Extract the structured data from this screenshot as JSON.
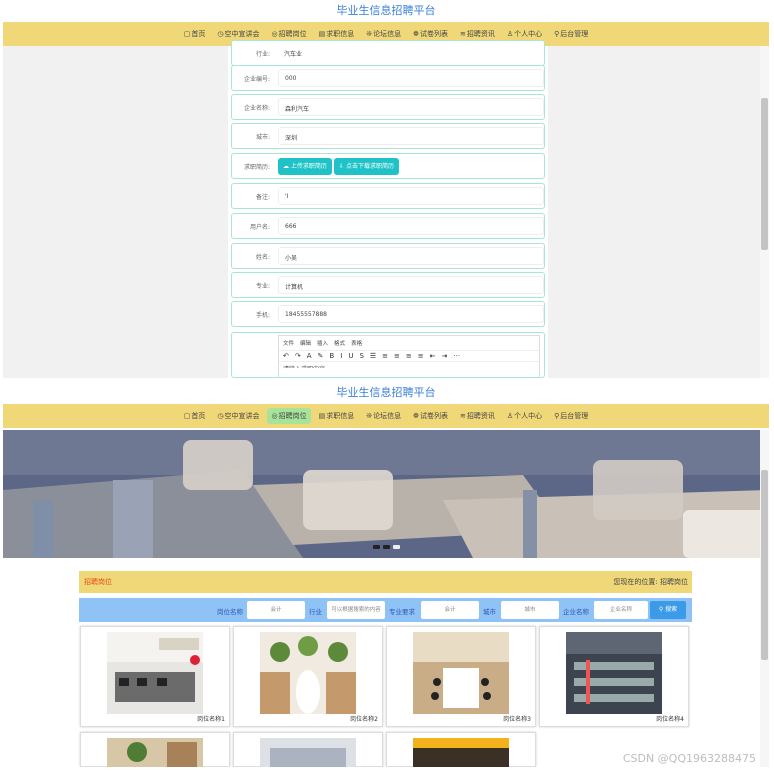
{
  "site_title": "毕业生信息招聘平台",
  "nav": [
    {
      "icon": "home-icon",
      "glyph": "▢",
      "label": "首页"
    },
    {
      "icon": "clock-icon",
      "glyph": "◷",
      "label": "空中宣讲会"
    },
    {
      "icon": "circle-icon",
      "glyph": "◎",
      "label": "招聘岗位"
    },
    {
      "icon": "list-icon",
      "glyph": "▤",
      "label": "求职信息"
    },
    {
      "icon": "forum-icon",
      "glyph": "❊",
      "label": "论坛信息"
    },
    {
      "icon": "paper-icon",
      "glyph": "❁",
      "label": "试卷列表"
    },
    {
      "icon": "news-icon",
      "glyph": "≋",
      "label": "招聘资讯"
    },
    {
      "icon": "user-icon",
      "glyph": "♙",
      "label": "个人中心"
    },
    {
      "icon": "link-icon",
      "glyph": "⚲",
      "label": "后台管理"
    }
  ],
  "shotA_active_nav": -1,
  "shotB_active_nav": 2,
  "form": {
    "industry": {
      "label": "行业:",
      "value": "汽车业"
    },
    "company_no": {
      "label": "企业编号:",
      "value": "000"
    },
    "company_name": {
      "label": "企业名称:",
      "value": "森利汽车"
    },
    "city": {
      "label": "城市:",
      "value": "深圳"
    },
    "resume": {
      "label": "求职简历:",
      "upload": "上传求职简历",
      "download": "点击下载求职简历"
    },
    "remark": {
      "label": "备注:",
      "value": "'I"
    },
    "username": {
      "label": "用户名:",
      "value": "666"
    },
    "name": {
      "label": "姓名:",
      "value": "小吴"
    },
    "major": {
      "label": "专业:",
      "value": "计算机"
    },
    "phone": {
      "label": "手机:",
      "value": "18455557888"
    },
    "editor_menu": [
      "文件",
      "编辑",
      "插入",
      "格式",
      "表格"
    ],
    "editor_tools": [
      "↶",
      "↷",
      "A",
      "✎",
      "B",
      "I",
      "U",
      "S",
      "☰",
      "≡",
      "≡",
      "≡",
      "≡",
      "⇤",
      "⇥",
      "···"
    ],
    "editor_text": "请输入求职内容"
  },
  "section": {
    "title": "招聘岗位",
    "location": "您现在的位置: 招聘岗位"
  },
  "search": {
    "fields": [
      {
        "label": "岗位名称",
        "placeholder": "会计"
      },
      {
        "label": "行业",
        "placeholder": "可以根据搜索的内容"
      },
      {
        "label": "专业要求",
        "placeholder": "会计"
      },
      {
        "label": "城市",
        "placeholder": "城市"
      },
      {
        "label": "企业名称",
        "placeholder": "企业名称"
      }
    ],
    "button": "搜索"
  },
  "cards": [
    {
      "name": "岗位名称1"
    },
    {
      "name": "岗位名称2"
    },
    {
      "name": "岗位名称3"
    },
    {
      "name": "岗位名称4"
    },
    {
      "name": ""
    },
    {
      "name": ""
    },
    {
      "name": ""
    }
  ],
  "watermark": "CSDN @QQ1963288475"
}
